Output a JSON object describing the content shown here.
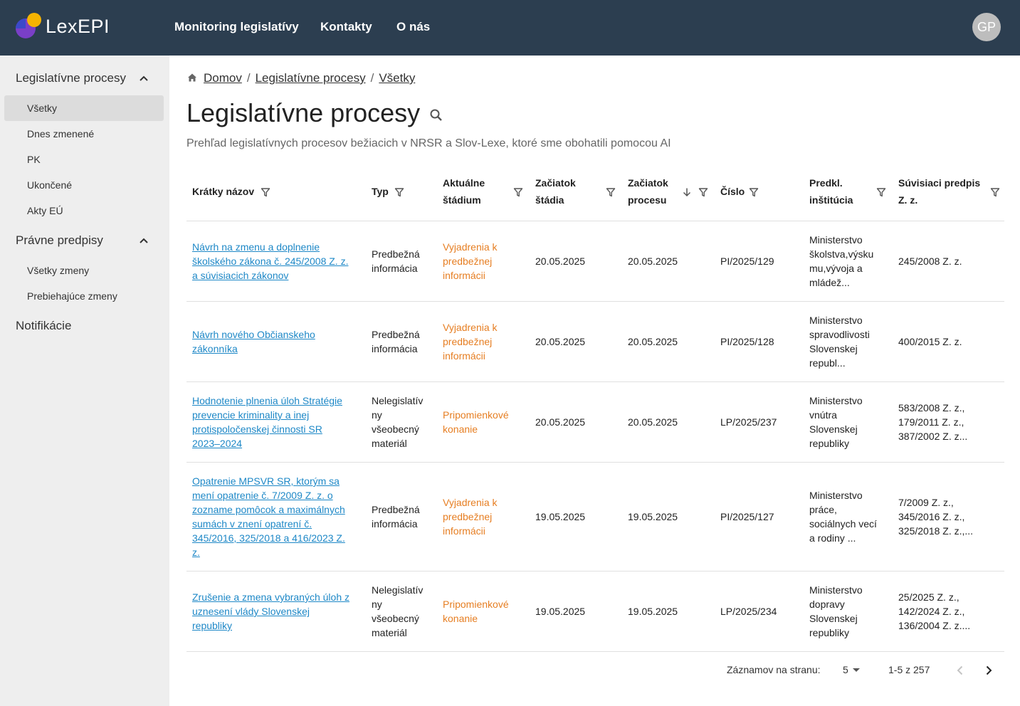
{
  "header": {
    "logo_text": "LexEPI",
    "nav": [
      "Monitoring legislatívy",
      "Kontakty",
      "O nás"
    ],
    "avatar_initials": "GP"
  },
  "sidebar": {
    "sections": [
      {
        "label": "Legislatívne procesy",
        "expanded": true,
        "items": [
          "Všetky",
          "Dnes zmenené",
          "PK",
          "Ukončené",
          "Akty EÚ"
        ]
      },
      {
        "label": "Právne predpisy",
        "expanded": true,
        "items": [
          "Všetky zmeny",
          "Prebiehajúce zmeny"
        ]
      },
      {
        "label": "Notifikácie"
      }
    ],
    "active_item": "Všetky"
  },
  "breadcrumb": [
    "Domov",
    "Legislatívne procesy",
    "Všetky"
  ],
  "page": {
    "title": "Legislatívne procesy",
    "subtitle": "Prehľad legislatívnych procesov bežiacich v NRSR a Slov-Lexe, ktoré sme obohatili pomocou AI"
  },
  "table": {
    "columns": [
      {
        "line1": "Krátky názov",
        "line2": ""
      },
      {
        "line1": "Typ",
        "line2": ""
      },
      {
        "line1": "Aktuálne",
        "line2": "štádium"
      },
      {
        "line1": "Začiatok",
        "line2": "štádia"
      },
      {
        "line1": "Začiatok",
        "line2": "procesu"
      },
      {
        "line1": "Číslo",
        "line2": ""
      },
      {
        "line1": "Predkl.",
        "line2": "inštitúcia"
      },
      {
        "line1": "Súvisiaci predpis",
        "line2": "Z. z."
      }
    ],
    "sort_column": "Začiatok procesu",
    "sort_direction": "descending",
    "rows": [
      {
        "name": [
          "Návrh na zmenu a doplnenie",
          "školského zákona č. 245/2008 Z. z.",
          "a súvisiacich zákonov"
        ],
        "type": [
          "Predbežná",
          "informácia"
        ],
        "stage": [
          "Vyjadrenia k",
          "predbežnej",
          "informácii"
        ],
        "stage_start": "20.05.2025",
        "process_start": "20.05.2025",
        "number": "PI/2025/129",
        "institution": [
          "Ministerstvo",
          "školstva,výsku",
          "mu,vývoja a",
          "mládež..."
        ],
        "related": [
          "245/2008 Z. z."
        ]
      },
      {
        "name": [
          "Návrh nového Občianskeho",
          "zákonníka"
        ],
        "type": [
          "Predbežná",
          "informácia"
        ],
        "stage": [
          "Vyjadrenia k",
          "predbežnej",
          "informácii"
        ],
        "stage_start": "20.05.2025",
        "process_start": "20.05.2025",
        "number": "PI/2025/128",
        "institution": [
          "Ministerstvo",
          "spravodlivosti",
          "Slovenskej",
          "republ..."
        ],
        "related": [
          "400/2015 Z. z."
        ]
      },
      {
        "name": [
          "Hodnotenie plnenia úloh Stratégie",
          "prevencie kriminality a inej",
          "protispoločenskej činnosti SR",
          "2023–2024"
        ],
        "type": [
          "Nelegislatív",
          "ny",
          "všeobecný",
          "materiál"
        ],
        "stage": [
          "Pripomienkové",
          "konanie"
        ],
        "stage_start": "20.05.2025",
        "process_start": "20.05.2025",
        "number": "LP/2025/237",
        "institution": [
          "Ministerstvo",
          "vnútra",
          "Slovenskej",
          "republiky"
        ],
        "related": [
          "583/2008 Z. z.,",
          "179/2011 Z. z.,",
          "387/2002 Z. z..."
        ]
      },
      {
        "name": [
          "Opatrenie MPSVR SR, ktorým sa",
          "mení opatrenie č. 7/2009 Z. z. o",
          "zozname pomôcok a maximálnych",
          "sumách v znení opatrení č.",
          "345/2016, 325/2018 a 416/2023 Z.",
          "z."
        ],
        "type": [
          "Predbežná",
          "informácia"
        ],
        "stage": [
          "Vyjadrenia k",
          "predbežnej",
          "informácii"
        ],
        "stage_start": "19.05.2025",
        "process_start": "19.05.2025",
        "number": "PI/2025/127",
        "institution": [
          "Ministerstvo",
          "práce,",
          "sociálnych vecí",
          "a rodiny ..."
        ],
        "related": [
          "7/2009 Z. z.,",
          "345/2016 Z. z.,",
          "325/2018 Z. z.,..."
        ]
      },
      {
        "name": [
          "Zrušenie a zmena vybraných úloh z",
          "uznesení vlády Slovenskej",
          "republiky"
        ],
        "type": [
          "Nelegislatív",
          "ny",
          "všeobecný",
          "materiál"
        ],
        "stage": [
          "Pripomienkové",
          "konanie"
        ],
        "stage_start": "19.05.2025",
        "process_start": "19.05.2025",
        "number": "LP/2025/234",
        "institution": [
          "Ministerstvo",
          "dopravy",
          "Slovenskej",
          "republiky"
        ],
        "related": [
          "25/2025 Z. z.,",
          "142/2024 Z. z.,",
          "136/2004 Z. z...."
        ]
      }
    ]
  },
  "pagination": {
    "rows_per_page_label": "Záznamov na stranu:",
    "rows_per_page": "5",
    "range": "1-5 z 257"
  },
  "colors": {
    "header_bg": "#2c3e50",
    "sidebar_bg": "#eeeeee",
    "link": "#1e88c7",
    "stage": "#e67e22",
    "logo_yellow": "#f5b301",
    "logo_blue": "#3b49c9",
    "logo_purple": "#7a3fc7"
  }
}
